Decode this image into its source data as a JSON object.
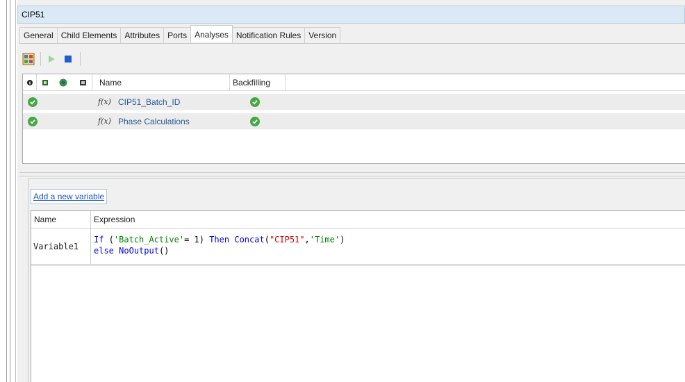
{
  "window": {
    "title": "CIP51"
  },
  "tabs": [
    {
      "label": "General",
      "active": false
    },
    {
      "label": "Child Elements",
      "active": false
    },
    {
      "label": "Attributes",
      "active": false
    },
    {
      "label": "Ports",
      "active": false
    },
    {
      "label": "Analyses",
      "active": true
    },
    {
      "label": "Notification Rules",
      "active": false
    },
    {
      "label": "Version",
      "active": false
    }
  ],
  "toolbar": {
    "icons": [
      "analysis-template-icon",
      "run-icon",
      "stop-icon"
    ]
  },
  "analyses_grid": {
    "header_icons": [
      "info-icon",
      "backfill-status-icon",
      "refresh-icon",
      "category-icon"
    ],
    "columns": {
      "name": "Name",
      "backfilling": "Backfilling"
    },
    "rows": [
      {
        "status": "ok",
        "type_icon": "f(x)",
        "name": "CIP51_Batch_ID",
        "backfilling": "ok"
      },
      {
        "status": "ok",
        "type_icon": "f(x)",
        "name": "Phase Calculations",
        "backfilling": "ok"
      }
    ]
  },
  "variables": {
    "add_link": "Add a new variable",
    "columns": {
      "name": "Name",
      "expression": "Expression"
    },
    "rows": [
      {
        "name": "Variable1",
        "expr_line1": {
          "t1": "If",
          "t2": " (",
          "t3": "'Batch_Active'",
          "t4": "= ",
          "t5": "1",
          "t6": ") ",
          "t7": "Then",
          "t8": " ",
          "t9": "Concat",
          "t10": "(",
          "t11": "\"CIP51\"",
          "t12": ",",
          "t13": "'Time'",
          "t14": ")"
        },
        "expr_line2": {
          "t1": "else",
          "t2": " ",
          "t3": "NoOutput",
          "t4": "()"
        }
      }
    ]
  },
  "colors": {
    "title_bar": "#dbe8f6",
    "link": "#1a56b8",
    "check": "#45a845",
    "keyword": "#0000e0",
    "string": "#d40000"
  }
}
